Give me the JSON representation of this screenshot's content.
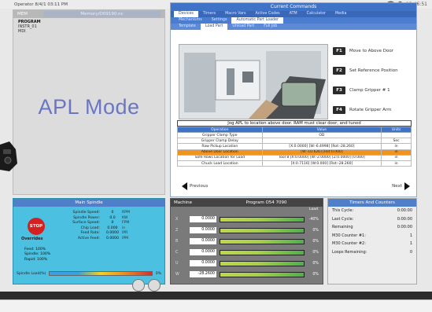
{
  "statusbar": {
    "left_text": "Operator  8/4/1 03:11 PM",
    "right_text": "13:46:51"
  },
  "left_panel": {
    "title_left": "MEM",
    "title_right": "Memory/O09190.nc",
    "files": [
      "PROGRAM",
      "INSTR_01",
      "MDI"
    ],
    "mode_label": "APL Mode"
  },
  "current_commands": {
    "title": "Current Commands",
    "tabs_row1": [
      "Devices",
      "Timers",
      "Macro Vars",
      "Active Codes",
      "ATM",
      "Calculator",
      "Media"
    ],
    "tabs_row2": [
      "Mechanisms",
      "Settings",
      "Automatic Part Loader"
    ],
    "tabs_row3": [
      "Template",
      "Load Part",
      "Unload Part",
      "Full Job"
    ],
    "active_tab": "Automatic Part Loader",
    "buttons": [
      {
        "key": "F1",
        "label": "Move to Above Door"
      },
      {
        "key": "F2",
        "label": "Set Reference Position"
      },
      {
        "key": "F3",
        "label": "Clamp Gripper # 1"
      },
      {
        "key": "F4",
        "label": "Rotate Gripper Arm"
      }
    ],
    "info_bar": "Jog APL to location above door. RAM must clear door, and tuned",
    "table": {
      "headers": [
        "Operation",
        "Value",
        "Units"
      ],
      "rows": [
        {
          "op": "Gripper Clamp Type",
          "val": "OD",
          "unit": "",
          "highlight": false
        },
        {
          "op": "Gripper Clamp Delay",
          "val": "",
          "unit": "Sec",
          "highlight": false
        },
        {
          "op": "Raw Pickup Location",
          "val": "[X:0.0000] [W:-6.4998] [Rot:-28.260]",
          "unit": "in",
          "highlight": false
        },
        {
          "op": "Above Door Location",
          "val": "[W:-10.626] [Rot:0.000]",
          "unit": "in",
          "highlight": true
        },
        {
          "op": "Safe Rows Location for Load",
          "val": "Tool 8 [X:0.0000] [W:-2.0000] [Z:0.0000] [0.000]",
          "unit": "in",
          "highlight": false
        },
        {
          "op": "Chuck Load Location",
          "val": "[X:0.7116] [W:0.000] [Rot:-28.260]",
          "unit": "in",
          "highlight": false
        }
      ]
    },
    "nav": {
      "previous": "Previous",
      "next": "Next"
    }
  },
  "main_spindle": {
    "title": "Main Spindle",
    "stop_label": "STOP",
    "overrides_label": "Overrides",
    "speed_rows": [
      {
        "label": "Spindle Speed:",
        "value": "0",
        "unit": "RPM"
      },
      {
        "label": "Spindle Power:",
        "value": "0.0",
        "unit": "KW"
      },
      {
        "label": "Surface Speed:",
        "value": "0",
        "unit": "FPM"
      },
      {
        "label": "Chip Load:",
        "value": "0.000",
        "unit": "in"
      },
      {
        "label": "Feed Rate:",
        "value": "0.0000",
        "unit": "IPR"
      },
      {
        "label": "Active Feed:",
        "value": "0.0000",
        "unit": "IPM"
      }
    ],
    "override_rows": [
      {
        "label": "Feed:",
        "value": "100%"
      },
      {
        "label": "Spindle:",
        "value": "100%"
      },
      {
        "label": "Rapid:",
        "value": "100%"
      }
    ],
    "spindle_load_label": "Spindle Load(%)",
    "spindle_load_value": "0%"
  },
  "program_panel": {
    "title_left": "Machine",
    "title_right": "Program O54 7090",
    "load_header": "Load",
    "axes": [
      {
        "name": "X",
        "value": "0.0000",
        "pct": "-40%"
      },
      {
        "name": "Z",
        "value": "0.0000",
        "pct": "0%"
      },
      {
        "name": "B",
        "value": "0.0000",
        "pct": "0%"
      },
      {
        "name": "C",
        "value": "0.0000",
        "pct": "0%"
      },
      {
        "name": "U",
        "value": "0.0000",
        "pct": "0%"
      },
      {
        "name": "W",
        "value": "-28.2600",
        "pct": "0%"
      }
    ]
  },
  "timers": {
    "title": "Timers And Counters",
    "rows": [
      {
        "label": "This Cycle:",
        "value": "0:00:00"
      },
      {
        "label": "Last Cycle:",
        "value": "0:00:00"
      },
      {
        "label": "Remaining",
        "value": "0:00:00"
      },
      {
        "label": "M30 Counter #1:",
        "value": "1"
      },
      {
        "label": "M30 Counter #2:",
        "value": "1"
      },
      {
        "label": "Loops Remaining:",
        "value": "0"
      }
    ]
  },
  "colors": {
    "accent_blue": "#3f73c7",
    "highlight_orange": "#f0941f",
    "spindle_panel": "#4cc0e0",
    "stop_red": "#d42020"
  }
}
